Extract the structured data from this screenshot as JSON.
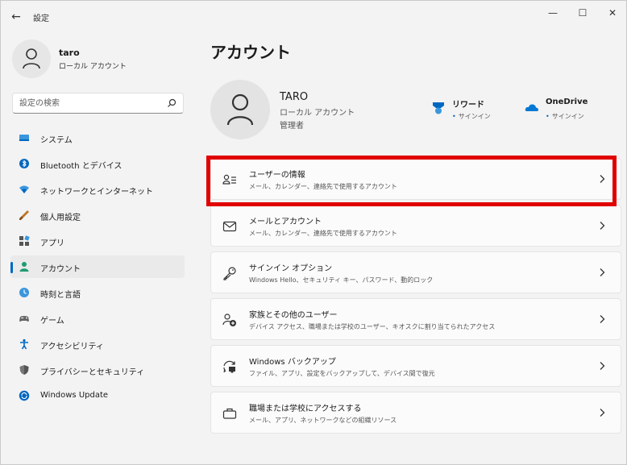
{
  "window": {
    "title": "設定",
    "back_icon": "←",
    "minimize_icon": "—",
    "maximize_icon": "☐",
    "close_icon": "✕"
  },
  "sidebar": {
    "profile": {
      "name": "taro",
      "account_type": "ローカル アカウント"
    },
    "search": {
      "placeholder": "設定の検索",
      "value": ""
    },
    "items": [
      {
        "label": "システム",
        "icon": "system-icon",
        "color": "#0067c0"
      },
      {
        "label": "Bluetooth とデバイス",
        "icon": "bluetooth-icon",
        "color": "#0067c0"
      },
      {
        "label": "ネットワークとインターネット",
        "icon": "network-icon",
        "color": "#0067c0"
      },
      {
        "label": "個人用設定",
        "icon": "personalization-icon",
        "color": "#c0762a"
      },
      {
        "label": "アプリ",
        "icon": "apps-icon",
        "color": "#555555"
      },
      {
        "label": "アカウント",
        "icon": "accounts-icon",
        "color": "#1e9c70",
        "selected": true
      },
      {
        "label": "時刻と言語",
        "icon": "time-language-icon",
        "color": "#0067c0"
      },
      {
        "label": "ゲーム",
        "icon": "gaming-icon",
        "color": "#555555"
      },
      {
        "label": "アクセシビリティ",
        "icon": "accessibility-icon",
        "color": "#0067c0"
      },
      {
        "label": "プライバシーとセキュリティ",
        "icon": "privacy-icon",
        "color": "#666666"
      },
      {
        "label": "Windows Update",
        "icon": "windows-update-icon",
        "color": "#0067c0"
      }
    ]
  },
  "main": {
    "title": "アカウント",
    "user": {
      "name": "TARO",
      "account_type": "ローカル アカウント",
      "role": "管理者"
    },
    "services": [
      {
        "label": "リワード",
        "status": "サインイン",
        "icon": "rewards-icon"
      },
      {
        "label": "OneDrive",
        "status": "サインイン",
        "icon": "onedrive-icon"
      }
    ],
    "rows": [
      {
        "title": "ユーザーの情報",
        "desc": "メール、カレンダー、連絡先で使用するアカウント",
        "icon": "user-info-icon"
      },
      {
        "title": "メールとアカウント",
        "desc": "メール、カレンダー、連絡先で使用するアカウント",
        "icon": "mail-icon"
      },
      {
        "title": "サインイン オプション",
        "desc": "Windows Hello、セキュリティ キー、パスワード、動的ロック",
        "icon": "key-icon"
      },
      {
        "title": "家族とその他のユーザー",
        "desc": "デバイス アクセス、職場または学校のユーザー、キオスクに割り当てられたアクセス",
        "icon": "family-icon"
      },
      {
        "title": "Windows バックアップ",
        "desc": "ファイル、アプリ、設定をバックアップして、デバイス間で復元",
        "icon": "backup-icon"
      },
      {
        "title": "職場または学校にアクセスする",
        "desc": "メール、アプリ、ネットワークなどの組織リソース",
        "icon": "briefcase-icon"
      }
    ]
  },
  "colors": {
    "accent": "#0067c0",
    "highlight_box": "#e00000"
  }
}
